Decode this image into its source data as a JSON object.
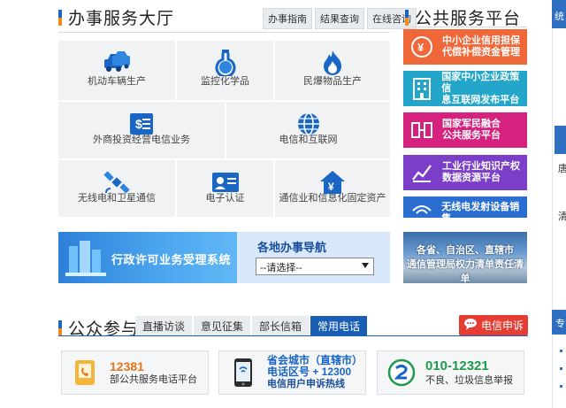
{
  "hall": {
    "title": "办事服务大厅",
    "tabs": [
      "办事指南",
      "结果查询",
      "在线咨询"
    ],
    "services": [
      {
        "label": "机动车辆生产",
        "icon": "vehicle-icon"
      },
      {
        "label": "监控化学品",
        "icon": "flask-icon"
      },
      {
        "label": "民爆物品生产",
        "icon": "flame-icon"
      },
      {
        "label": "外商投资经营电信业务",
        "icon": "dollar-doc-icon"
      },
      {
        "label": "电信和互联网",
        "icon": "globe-icon"
      },
      {
        "label": "无线电和卫星通信",
        "icon": "satellite-icon"
      },
      {
        "label": "电子认证",
        "icon": "id-card-icon"
      },
      {
        "label": "通信业和信息化固定资产",
        "icon": "house-yuan-icon"
      }
    ],
    "banner_text": "行政许可业务受理系统",
    "guide": {
      "title": "各地办事导航",
      "select_value": "--请选择--"
    }
  },
  "platform": {
    "title": "公共服务平台",
    "items": [
      {
        "line1": "中小企业信用担保",
        "line2": "代偿补偿资金管理",
        "color": "#f0683a",
        "icon": "coin-icon"
      },
      {
        "line1": "国家中小企业政策信",
        "line2": "息互联网发布平台",
        "color": "#23a6c9",
        "icon": "building-icon"
      },
      {
        "line1": "国家军民融合",
        "line2": "公共服务平台",
        "color": "#d6227f",
        "icon": "merge-icon"
      },
      {
        "line1": "工业行业知识产权",
        "line2": "数据资源平台",
        "color": "#7a3ec8",
        "icon": "chart-icon"
      },
      {
        "line1": "无线电发射设备销售",
        "line2": "",
        "color": "#2a6fd0",
        "icon": "wifi-icon"
      }
    ],
    "photo_line1": "各省、自治区、直辖市",
    "photo_line2": "通信管理局权力清单责任清单"
  },
  "edge": {
    "top": "统",
    "chars": [
      "唐",
      "清"
    ],
    "bottom": "专"
  },
  "public": {
    "title": "公众参与",
    "tabs": [
      "直播访谈",
      "意见征集",
      "部长信箱",
      "常用电话"
    ],
    "active_tab": "常用电话",
    "complaint_label": "电信申诉",
    "hotlines": [
      {
        "number": "12381",
        "desc": "部公共服务电话平台",
        "icon": "phone-icon"
      },
      {
        "line1": "省会城市（直辖市）",
        "line2": "电话区号 + 12300",
        "line3": "电信用户申诉热线",
        "icon": "mobile-icon"
      },
      {
        "number": "010-12321",
        "desc": "不良、垃圾信息举报",
        "icon": "report-icon"
      }
    ]
  }
}
